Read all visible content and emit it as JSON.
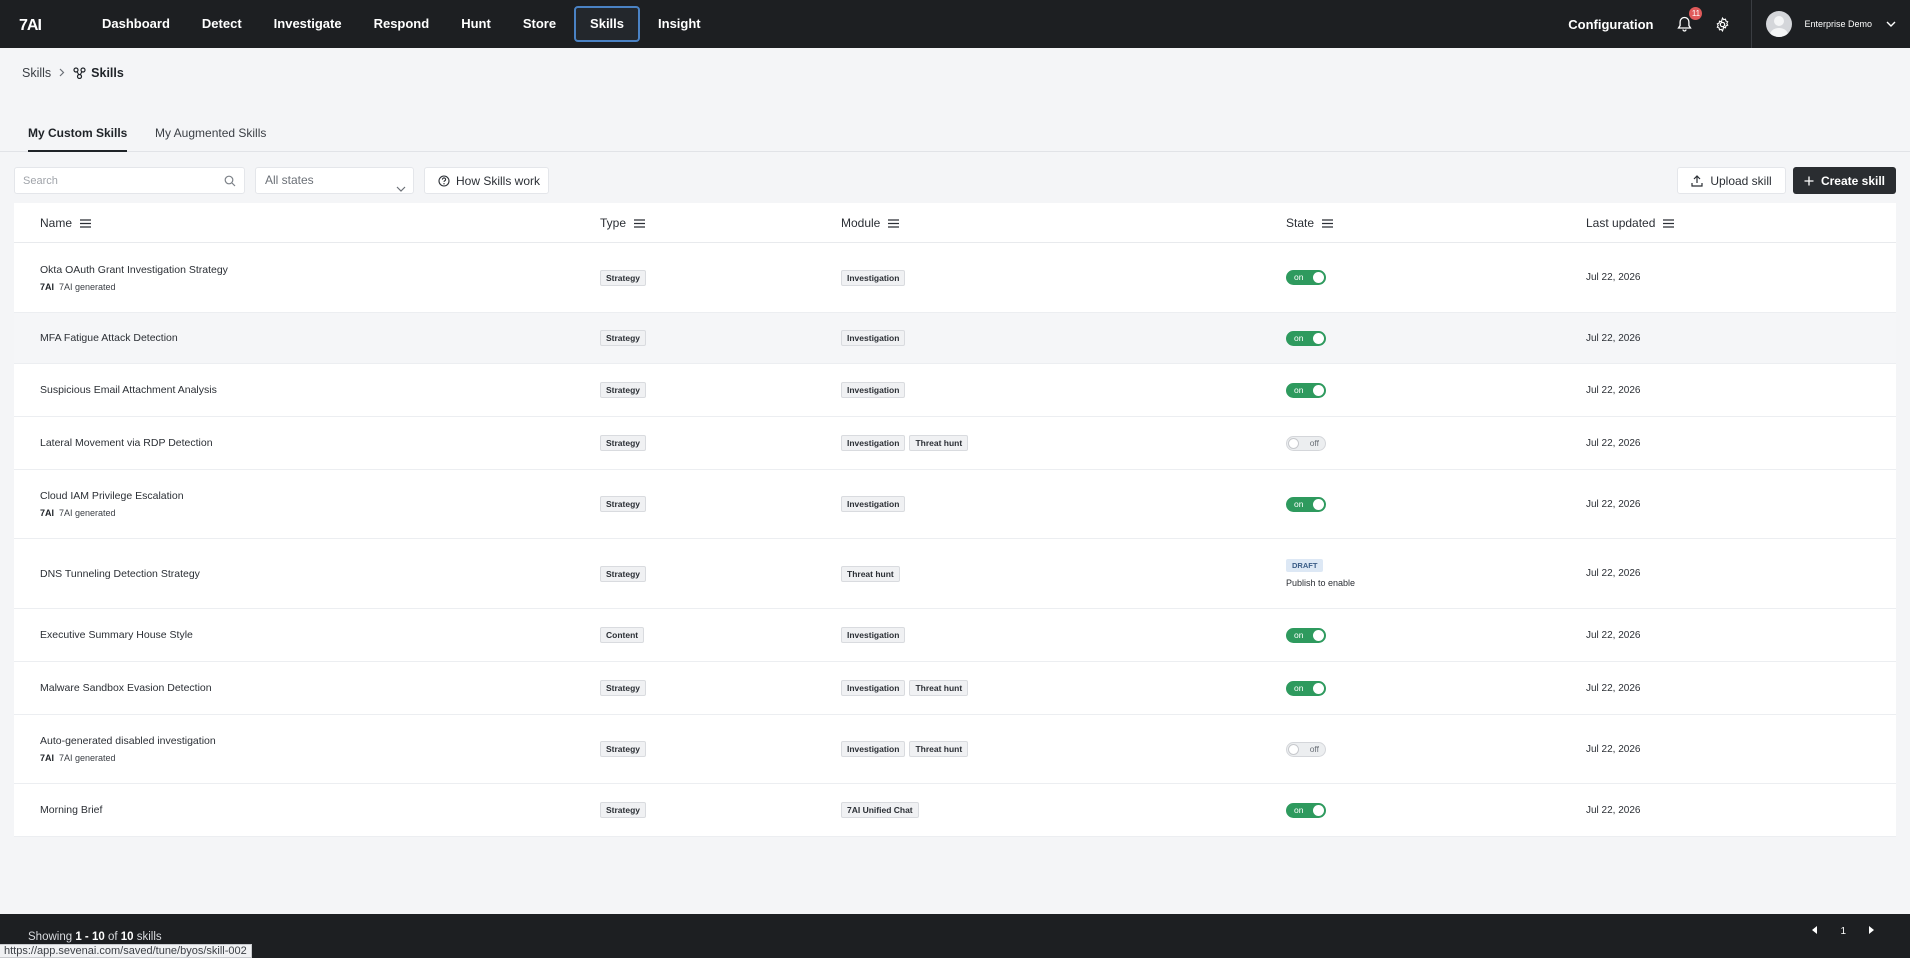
{
  "nav": {
    "logo": "7AI",
    "items": [
      {
        "label": "Dashboard",
        "active": false
      },
      {
        "label": "Detect",
        "active": false
      },
      {
        "label": "Investigate",
        "active": false
      },
      {
        "label": "Respond",
        "active": false
      },
      {
        "label": "Hunt",
        "active": false
      },
      {
        "label": "Store",
        "active": false
      },
      {
        "label": "Skills",
        "active": true
      },
      {
        "label": "Insight",
        "active": false
      }
    ],
    "configuration": "Configuration",
    "notification_count": "11",
    "user_name": "Enterprise Demo"
  },
  "breadcrumb": {
    "parent": "Skills",
    "current": "Skills"
  },
  "tabs": [
    {
      "label": "My Custom Skills",
      "active": true
    },
    {
      "label": "My Augmented Skills",
      "active": false
    }
  ],
  "toolbar": {
    "search_placeholder": "Search",
    "state_filter": "All states",
    "how_label": "How Skills work",
    "upload_label": "Upload skill",
    "create_label": "Create skill"
  },
  "table": {
    "columns": [
      "Name",
      "Type",
      "Module",
      "State",
      "Last updated"
    ],
    "rows": [
      {
        "name": "Okta OAuth Grant Investigation Strategy",
        "generated": "7AI generated",
        "type": "Strategy",
        "modules": [
          "Investigation"
        ],
        "state": "on",
        "updated": "Jul 22, 2026"
      },
      {
        "name": "MFA Fatigue Attack Detection",
        "generated": "",
        "type": "Strategy",
        "modules": [
          "Investigation"
        ],
        "state": "on",
        "updated": "Jul 22, 2026"
      },
      {
        "name": "Suspicious Email Attachment Analysis",
        "generated": "",
        "type": "Strategy",
        "modules": [
          "Investigation"
        ],
        "state": "on",
        "updated": "Jul 22, 2026"
      },
      {
        "name": "Lateral Movement via RDP Detection",
        "generated": "",
        "type": "Strategy",
        "modules": [
          "Investigation",
          "Threat hunt"
        ],
        "state": "off",
        "updated": "Jul 22, 2026"
      },
      {
        "name": "Cloud IAM Privilege Escalation",
        "generated": "7AI generated",
        "type": "Strategy",
        "modules": [
          "Investigation"
        ],
        "state": "on",
        "updated": "Jul 22, 2026"
      },
      {
        "name": "DNS Tunneling Detection Strategy",
        "generated": "",
        "type": "Strategy",
        "modules": [
          "Threat hunt"
        ],
        "state": "draft",
        "draft_label": "DRAFT",
        "draft_sub": "Publish to enable",
        "updated": "Jul 22, 2026"
      },
      {
        "name": "Executive Summary House Style",
        "generated": "",
        "type": "Content",
        "modules": [
          "Investigation"
        ],
        "state": "on",
        "updated": "Jul 22, 2026"
      },
      {
        "name": "Malware Sandbox Evasion Detection",
        "generated": "",
        "type": "Strategy",
        "modules": [
          "Investigation",
          "Threat hunt"
        ],
        "state": "on",
        "updated": "Jul 22, 2026"
      },
      {
        "name": "Auto-generated disabled investigation",
        "generated": "7AI generated",
        "type": "Strategy",
        "modules": [
          "Investigation",
          "Threat hunt"
        ],
        "state": "off",
        "updated": "Jul 22, 2026"
      },
      {
        "name": "Morning Brief",
        "generated": "",
        "type": "Strategy",
        "modules": [
          "7AI Unified Chat"
        ],
        "state": "on",
        "updated": "Jul 22, 2026"
      }
    ],
    "gen_mark": "7AI",
    "on_label": "on",
    "off_label": "off"
  },
  "footer": {
    "showing_prefix": "Showing",
    "range": "1 - 10",
    "of": "of",
    "total": "10",
    "suffix": "skills",
    "page": "1"
  },
  "status_url": "https://app.sevenai.com/saved/tune/byos/skill-002"
}
